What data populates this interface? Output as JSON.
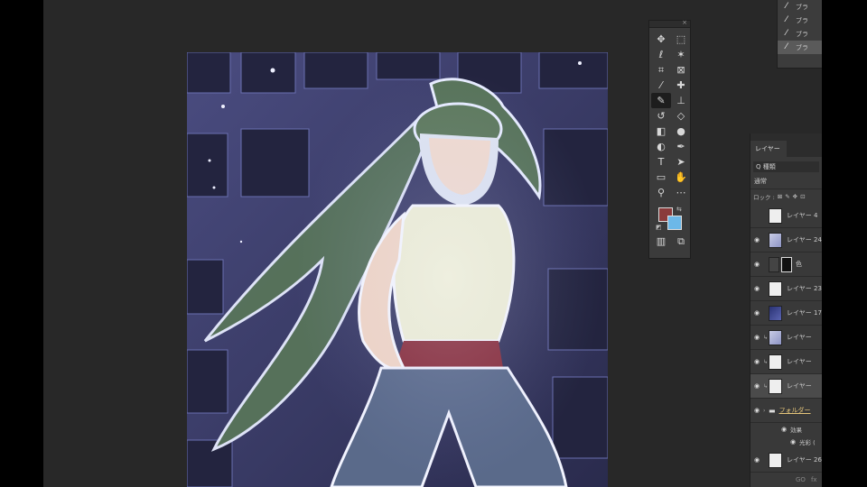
{
  "presets": {
    "items": [
      {
        "label": "ブラ",
        "selected": false
      },
      {
        "label": "ブラ",
        "selected": false
      },
      {
        "label": "ブラ",
        "selected": false
      },
      {
        "label": "ブラ",
        "selected": true
      }
    ]
  },
  "tools": {
    "close_label": "×",
    "items": [
      {
        "name": "move-tool",
        "glyph": "✥",
        "active": false
      },
      {
        "name": "marquee-tool",
        "glyph": "⬚",
        "active": false
      },
      {
        "name": "lasso-tool",
        "glyph": "ℓ",
        "active": false
      },
      {
        "name": "magic-wand-tool",
        "glyph": "✶",
        "active": false
      },
      {
        "name": "crop-tool",
        "glyph": "⌗",
        "active": false
      },
      {
        "name": "frame-tool",
        "glyph": "⊠",
        "active": false
      },
      {
        "name": "eyedropper-tool",
        "glyph": "⁄",
        "active": false
      },
      {
        "name": "healing-tool",
        "glyph": "✚",
        "active": false
      },
      {
        "name": "brush-tool",
        "glyph": "✎",
        "active": true
      },
      {
        "name": "stamp-tool",
        "glyph": "⊥",
        "active": false
      },
      {
        "name": "history-brush-tool",
        "glyph": "↺",
        "active": false
      },
      {
        "name": "eraser-tool",
        "glyph": "◇",
        "active": false
      },
      {
        "name": "gradient-tool",
        "glyph": "◧",
        "active": false
      },
      {
        "name": "blur-tool",
        "glyph": "●",
        "active": false
      },
      {
        "name": "dodge-tool",
        "glyph": "◐",
        "active": false
      },
      {
        "name": "pen-tool",
        "glyph": "✒",
        "active": false
      },
      {
        "name": "type-tool",
        "glyph": "T",
        "active": false
      },
      {
        "name": "path-select-tool",
        "glyph": "➤",
        "active": false
      },
      {
        "name": "shape-tool",
        "glyph": "▭",
        "active": false
      },
      {
        "name": "hand-tool",
        "glyph": "✋",
        "active": false
      },
      {
        "name": "zoom-tool",
        "glyph": "⚲",
        "active": false
      },
      {
        "name": "more-tools",
        "glyph": "⋯",
        "active": false
      }
    ],
    "swap_glyph": "⇆",
    "default_glyph": "◩",
    "bottom": [
      {
        "name": "quick-mask-button",
        "glyph": "▥"
      },
      {
        "name": "screen-mode-button",
        "glyph": "⧉"
      }
    ],
    "colors": {
      "foreground": "#8a3b3b",
      "background": "#6cb8e8"
    }
  },
  "layers_panel": {
    "tab_label": "レイヤー",
    "search_label": "Q 種類",
    "blend_mode": "通常",
    "lock_label": "ロック :",
    "lock_icons": [
      "⊠",
      "✎",
      "✥",
      "⊡"
    ],
    "layers": [
      {
        "name": "レイヤー 4",
        "visible": false,
        "thumb": "white",
        "clipped": false,
        "selected": false
      },
      {
        "name": "レイヤー 24",
        "visible": true,
        "thumb": "scene",
        "clipped": false,
        "selected": false
      },
      {
        "name": "色",
        "visible": true,
        "thumb": "adjust",
        "clipped": false,
        "selected": false
      },
      {
        "name": "レイヤー 23",
        "visible": true,
        "thumb": "white",
        "clipped": false,
        "selected": false
      },
      {
        "name": "レイヤー 17",
        "visible": true,
        "thumb": "dark",
        "clipped": false,
        "selected": false
      },
      {
        "name": "レイヤー",
        "visible": true,
        "thumb": "scene",
        "clipped": true,
        "selected": false
      },
      {
        "name": "レイヤー",
        "visible": true,
        "thumb": "white",
        "clipped": true,
        "selected": false
      },
      {
        "name": "レイヤー",
        "visible": true,
        "thumb": "white",
        "clipped": true,
        "selected": true
      }
    ],
    "folder": {
      "name": "フォルダー",
      "visible": true
    },
    "effects_label": "効果",
    "effect_item": "光彩 (",
    "last_layer": {
      "name": "レイヤー 26",
      "visible": true
    },
    "footer": [
      "GO",
      "fx"
    ]
  }
}
